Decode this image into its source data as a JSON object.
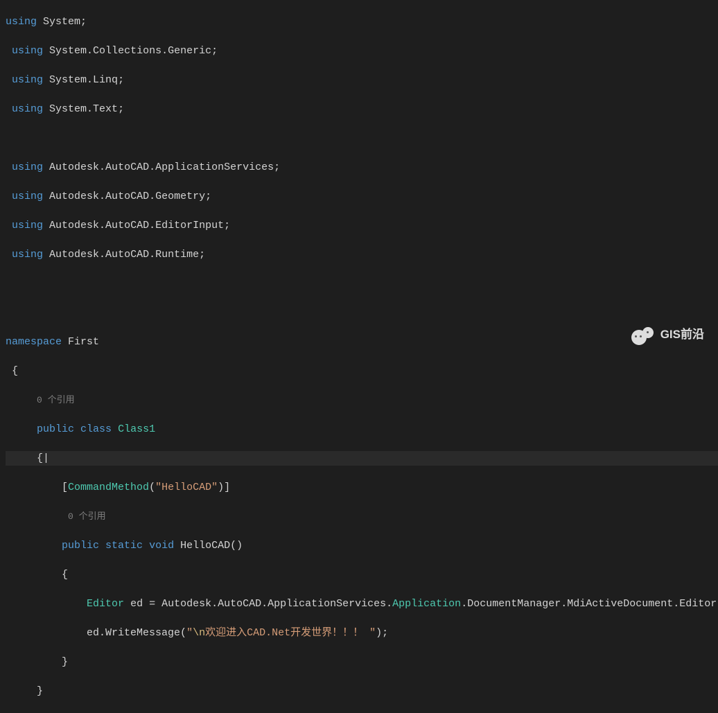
{
  "code": {
    "using": [
      "System",
      "System.Collections.Generic",
      "System.Linq",
      "System.Text",
      "Autodesk.AutoCAD.ApplicationServices",
      "Autodesk.AutoCAD.Geometry",
      "Autodesk.AutoCAD.EditorInput",
      "Autodesk.AutoCAD.Runtime"
    ],
    "kw_using": "using",
    "semi": ";",
    "kw_namespace": "namespace",
    "ns_name": "First",
    "brace_open": "{",
    "brace_close": "}",
    "ref_text": "0 个引用",
    "kw_public": "public",
    "kw_class": "class",
    "class_name": "Class1",
    "attr_open": "[",
    "attr_name": "CommandMethod",
    "attr_paren_open": "(",
    "attr_arg": "\"HelloCAD\"",
    "attr_paren_close": ")",
    "attr_close": "]",
    "kw_static": "static",
    "kw_void": "void",
    "method_name": "HelloCAD",
    "method_parens": "()",
    "t_editor": "Editor",
    "v_ed": "ed",
    "eq": " = ",
    "expr_left": "Autodesk.AutoCAD.ApplicationServices.",
    "t_application": "Application",
    "expr_right": ".DocumentManager.MdiActiveDocument.Editor;",
    "call_left": "ed.WriteMessage(",
    "str_quote_open": "\"",
    "str_esc": "\\n",
    "str_body": "欢迎进入CAD.Net开发世界！！！ ",
    "str_quote_close": "\"",
    "call_right": ");"
  },
  "watermark": {
    "text": "GIS前沿"
  }
}
